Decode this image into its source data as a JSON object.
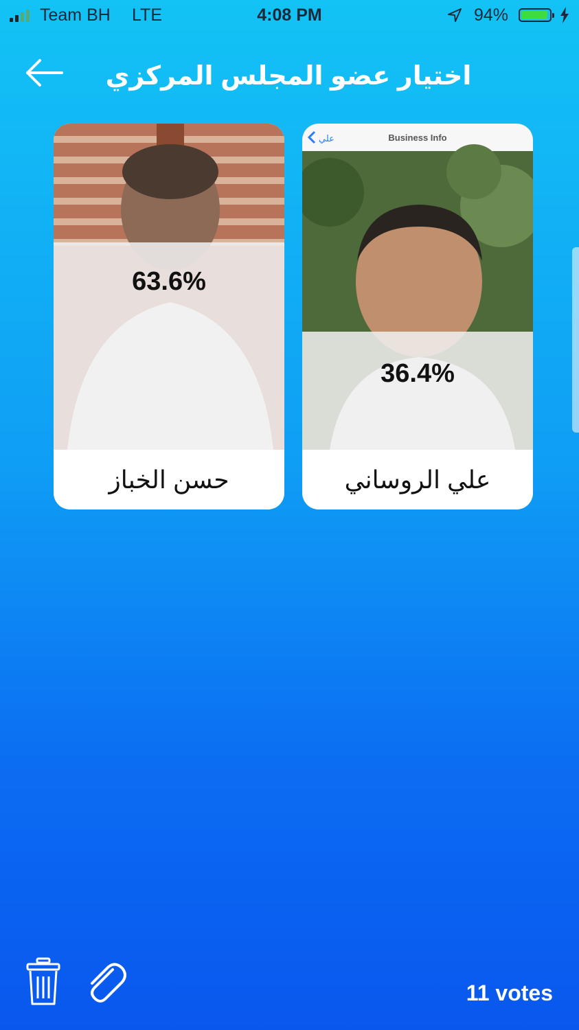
{
  "status_bar": {
    "carrier": "Team BH",
    "network": "LTE",
    "time": "4:08 PM",
    "battery": "94%",
    "battery_level": 0.94
  },
  "header": {
    "title": "اختيار عضو المجلس المركزي"
  },
  "candidates": [
    {
      "name": "حسن الخباز",
      "percent": "63.6%"
    },
    {
      "name": "علي الروساني",
      "percent": "36.4%",
      "photo_back_label": "علي",
      "photo_header_label": "Business Info"
    }
  ],
  "footer": {
    "votes": "11 votes"
  },
  "icons": [
    "signal-icon",
    "location-arrow-icon",
    "battery-icon",
    "charging-bolt-icon",
    "back-arrow-icon",
    "trash-icon",
    "paperclip-icon"
  ]
}
